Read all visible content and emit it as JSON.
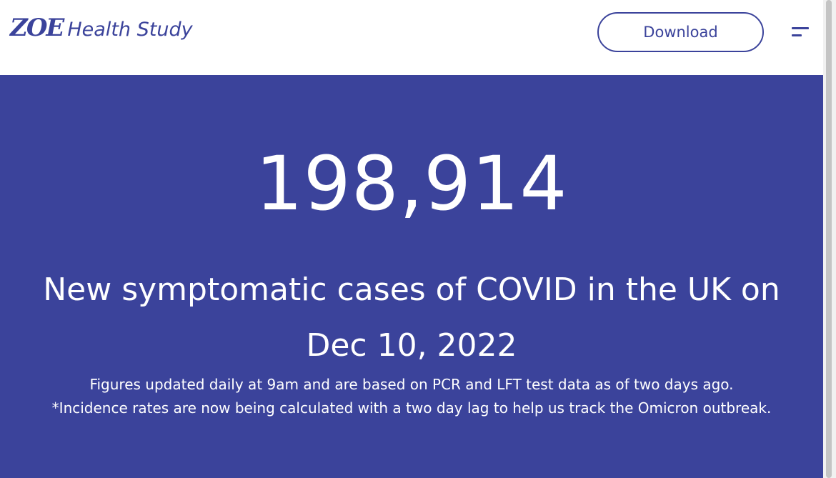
{
  "header": {
    "logo_mark": "ZOE",
    "logo_text": "Health Study",
    "download_label": "Download",
    "menu_icon": "hamburger-icon"
  },
  "hero": {
    "case_count": "198,914",
    "headline_prefix": "New symptomatic cases of COVID in the UK on",
    "headline_date": "Dec 10, 2022",
    "note_1": "Figures updated daily at 9am and are based on PCR and LFT test data as of two days ago.",
    "note_2": "*Incidence rates are now being calculated with a two day lag to help us track the Omicron outbreak."
  },
  "colors": {
    "brand": "#3b439b",
    "background": "#ffffff",
    "hero_text": "#ffffff"
  }
}
